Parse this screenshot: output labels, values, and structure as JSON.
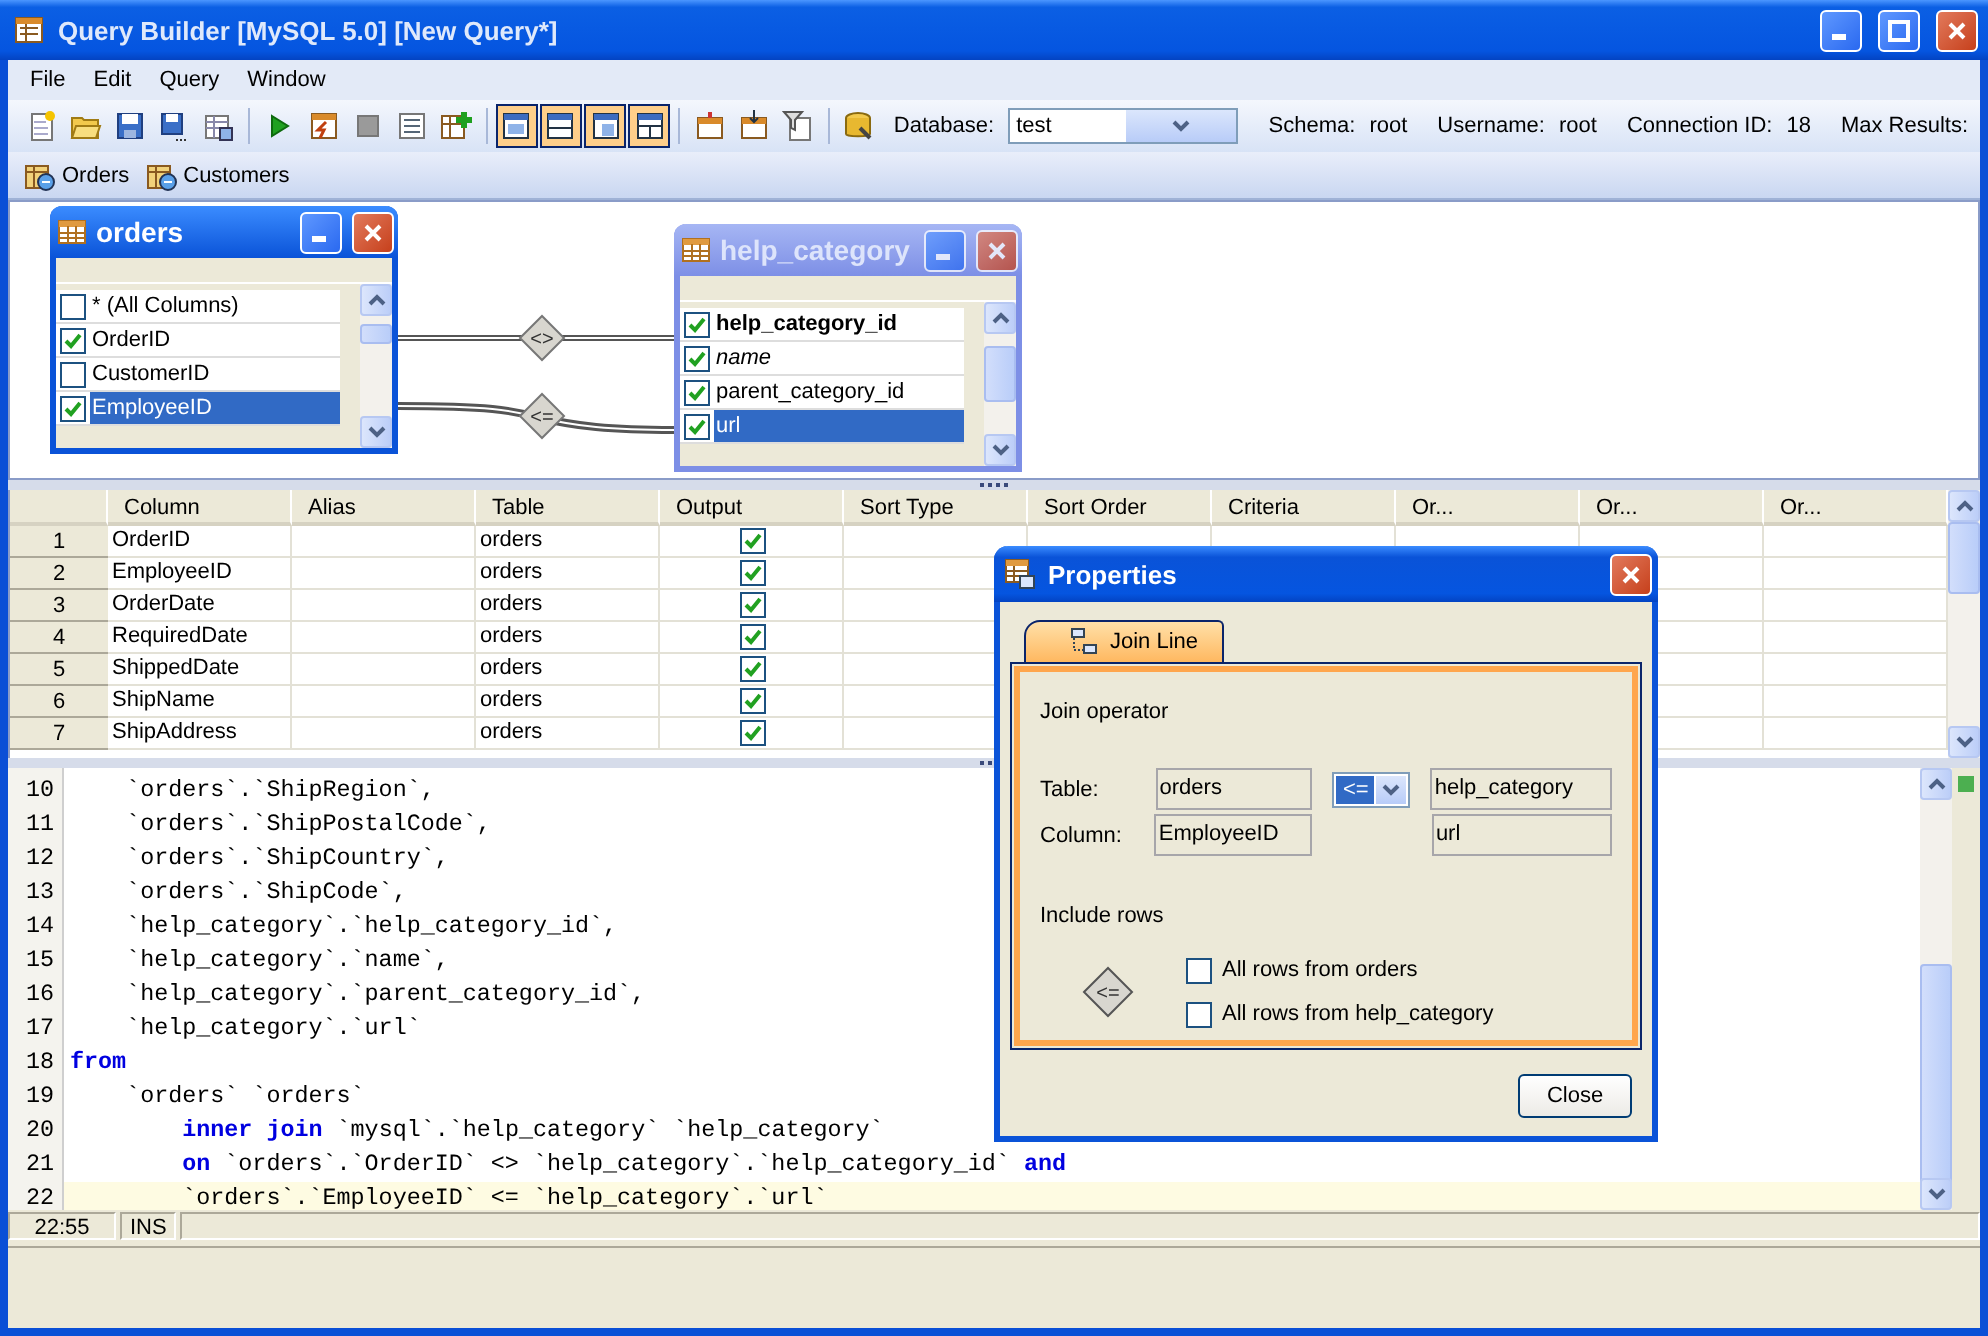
{
  "window": {
    "title": "Query Builder [MySQL 5.0] [New Query*]"
  },
  "menu": [
    "File",
    "Edit",
    "Query",
    "Window"
  ],
  "toolbar": {
    "buttons": [
      {
        "pressed": false
      },
      {
        "pressed": false
      },
      {
        "pressed": false
      },
      {
        "pressed": false
      },
      {
        "pressed": false
      },
      {
        "pressed": false
      },
      {
        "pressed": false
      },
      {
        "pressed": false
      },
      {
        "pressed": false
      },
      {
        "pressed": false
      },
      {
        "pressed": true
      },
      {
        "pressed": true
      },
      {
        "pressed": true
      },
      {
        "pressed": true
      },
      {
        "pressed": false
      },
      {
        "pressed": false
      },
      {
        "pressed": false
      },
      {
        "pressed": false
      }
    ],
    "database_label": "Database:",
    "database": "test",
    "info": [
      {
        "label": "Schema:",
        "value": "root"
      },
      {
        "label": "Username:",
        "value": "root"
      },
      {
        "label": "Connection ID:",
        "value": "18"
      },
      {
        "label": "Max Results:"
      }
    ]
  },
  "query_tabs": [
    {
      "label": "Orders"
    },
    {
      "label": "Customers"
    }
  ],
  "diagram": {
    "tables": [
      {
        "name": "orders",
        "active": true,
        "columns": [
          {
            "name": "* (All Columns)",
            "kind": "plain",
            "checked": false,
            "selected": false
          },
          {
            "name": "OrderID",
            "kind": "plain",
            "checked": true,
            "selected": false
          },
          {
            "name": "CustomerID",
            "kind": "plain",
            "checked": false,
            "selected": false
          },
          {
            "name": "EmployeeID",
            "kind": "plain",
            "checked": true,
            "selected": true
          }
        ]
      },
      {
        "name": "help_category",
        "active": false,
        "columns": [
          {
            "name": "help_category_id",
            "kind": "key",
            "checked": true,
            "selected": false
          },
          {
            "name": "name",
            "kind": "italic",
            "checked": true,
            "selected": false
          },
          {
            "name": "parent_category_id",
            "kind": "plain",
            "checked": true,
            "selected": false
          },
          {
            "name": "url",
            "kind": "plain",
            "checked": true,
            "selected": true
          }
        ]
      }
    ],
    "joins": [
      {
        "operator": "<>"
      },
      {
        "operator": "<="
      }
    ]
  },
  "grid": {
    "columns": [
      "Column",
      "Alias",
      "Table",
      "Output",
      "Sort Type",
      "Sort Order",
      "Criteria",
      "Or...",
      "Or...",
      "Or..."
    ],
    "rows": [
      {
        "number": "1",
        "column": "OrderID",
        "table": "orders",
        "output": true
      },
      {
        "number": "2",
        "column": "EmployeeID",
        "table": "orders",
        "output": true
      },
      {
        "number": "3",
        "column": "OrderDate",
        "table": "orders",
        "output": true
      },
      {
        "number": "4",
        "column": "RequiredDate",
        "table": "orders",
        "output": true
      },
      {
        "number": "5",
        "column": "ShippedDate",
        "table": "orders",
        "output": true
      },
      {
        "number": "6",
        "column": "ShipName",
        "table": "orders",
        "output": true
      },
      {
        "number": "7",
        "column": "ShipAddress",
        "table": "orders",
        "output": true
      }
    ]
  },
  "sql": {
    "lines": [
      {
        "number": "10",
        "code": "    `orders`.`ShipRegion`,",
        "current": false
      },
      {
        "number": "11",
        "code": "    `orders`.`ShipPostalCode`,",
        "current": false
      },
      {
        "number": "12",
        "code": "    `orders`.`ShipCountry`,",
        "current": false
      },
      {
        "number": "13",
        "code": "    `orders`.`ShipCode`,",
        "current": false
      },
      {
        "number": "14",
        "code": "    `help_category`.`help_category_id`,",
        "current": false
      },
      {
        "number": "15",
        "code": "    `help_category`.`name`,",
        "current": false
      },
      {
        "number": "16",
        "code": "    `help_category`.`parent_category_id`,",
        "current": false
      },
      {
        "number": "17",
        "code": "    `help_category`.`url`",
        "current": false
      },
      {
        "number": "18",
        "code": "**from**",
        "current": false
      },
      {
        "number": "19",
        "code": "    `orders` `orders`",
        "current": false
      },
      {
        "number": "20",
        "code": "        **inner** **join** `mysql`.`help_category` `help_category`",
        "current": false
      },
      {
        "number": "21",
        "code": "        **on** `orders`.`OrderID` <> `help_category`.`help_category_id` **and**",
        "current": false
      },
      {
        "number": "22",
        "code": "        `orders`.`EmployeeID` <= `help_category`.`url`",
        "current": true
      }
    ]
  },
  "status_bar": {
    "position": "22:55",
    "mode": "INS"
  },
  "properties_dialog": {
    "title": "Properties",
    "tabs": [
      {
        "label": "Join Line",
        "selected": true
      }
    ],
    "join_operator_label": "Join operator",
    "table_label": "Table:",
    "column_label": "Column:",
    "left": {
      "table": "orders",
      "column": "EmployeeID"
    },
    "operator": "<=",
    "right": {
      "table": "help_category",
      "column": "url"
    },
    "include_rows_label": "Include rows",
    "marker_operator": "<=",
    "options": [
      {
        "label": "All rows from orders",
        "checked": false
      },
      {
        "label": "All rows from help_category",
        "checked": false
      }
    ],
    "close_button": "Close"
  }
}
